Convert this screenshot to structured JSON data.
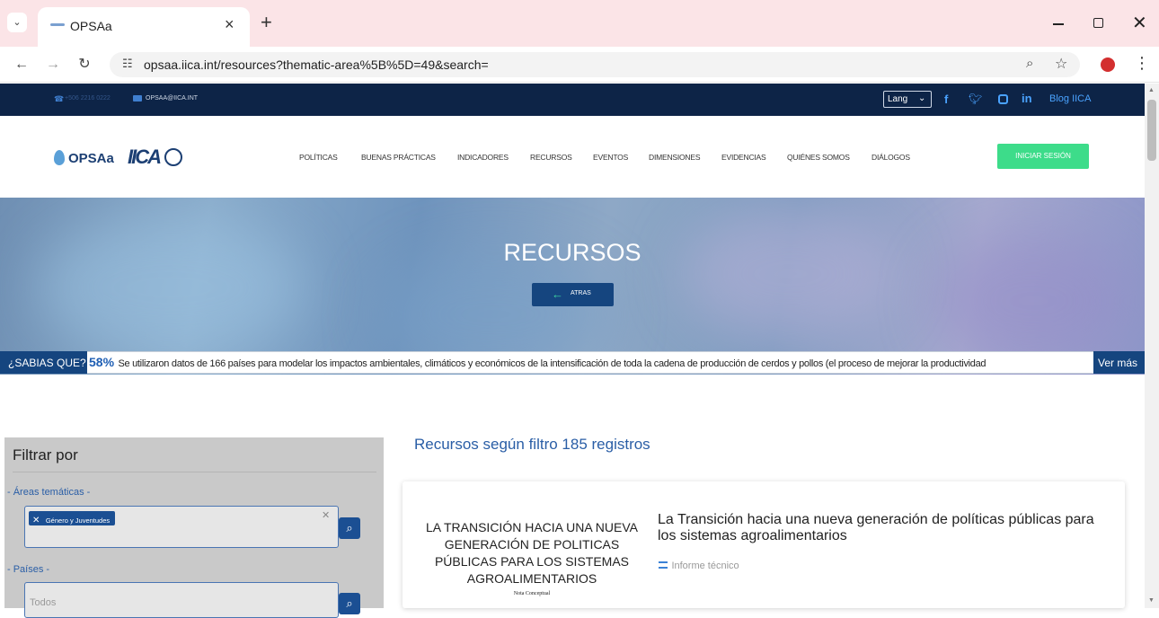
{
  "browser": {
    "tab_title": "OPSAa",
    "tab_close": "×",
    "new_tab": "+",
    "url": "opsaa.iica.int/resources?thematic-area%5B%5D=49&search="
  },
  "topbar": {
    "phone": "+506 2216 0222",
    "email": "OPSAA@IICA.INT",
    "lang_label": "Lang",
    "blog_label": "Blog IICA"
  },
  "header": {
    "logo_text": "OPSAa",
    "logo_iica": "IICA",
    "nav": [
      "POLÍTICAS",
      "BUENAS PRÁCTICAS",
      "INDICADORES",
      "RECURSOS",
      "EVENTOS",
      "DIMENSIONES",
      "EVIDENCIAS",
      "QUIÉNES SOMOS",
      "DIÁLOGOS"
    ],
    "login_label": "INICIAR SESIÓN"
  },
  "hero": {
    "title": "RECURSOS",
    "back_label": "ATRAS"
  },
  "ticker": {
    "label": "¿SABIAS QUE?",
    "number": "58%",
    "text": "Se utilizaron datos de 166 países para modelar los impactos ambientales, climáticos y económicos de la intensificación de toda la cadena de producción de cerdos y pollos (el proceso de mejorar la productividad",
    "more_label": "Ver más"
  },
  "filter": {
    "title": "Filtrar por",
    "thematic_label": "- Áreas temáticas -",
    "thematic_tag": "Género y Juventudes",
    "countries_label": "- Países -",
    "countries_placeholder": "Todos"
  },
  "results": {
    "heading": "Recursos según filtro 185 registros",
    "items": [
      {
        "thumb_title": "LA TRANSICIÓN HACIA UNA NUEVA GENERACIÓN DE POLITICAS PÚBLICAS PARA LOS SISTEMAS AGROALIMENTARIOS",
        "thumb_subtitle": "Nota Conceptual",
        "title": "La Transición hacia una nueva generación de políticas públicas para los sistemas agroalimentarios",
        "type": "Informe técnico"
      }
    ]
  }
}
